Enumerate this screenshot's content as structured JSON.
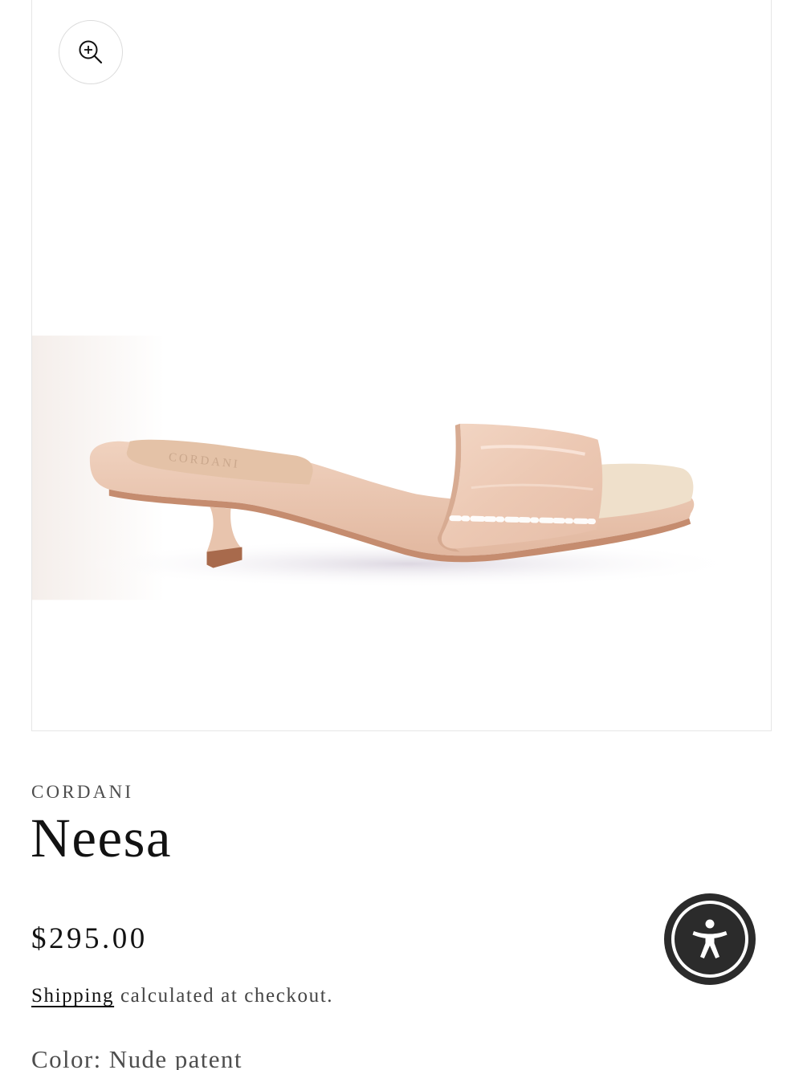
{
  "product": {
    "vendor": "CORDANI",
    "title": "Neesa",
    "price": "$295.00",
    "shipping_link": "Shipping",
    "shipping_rest": " calculated at checkout.",
    "color_label": "Color:",
    "color_value": "Nude patent"
  },
  "image": {
    "insole_logo": "CORDANI"
  },
  "icons": {
    "zoom": "zoom-in-icon",
    "accessibility": "accessibility-icon"
  },
  "colors": {
    "text": "#121212",
    "muted": "#4d4d4d",
    "shoe": "#ecc9b3",
    "a11y_button": "#2b2b2b"
  }
}
